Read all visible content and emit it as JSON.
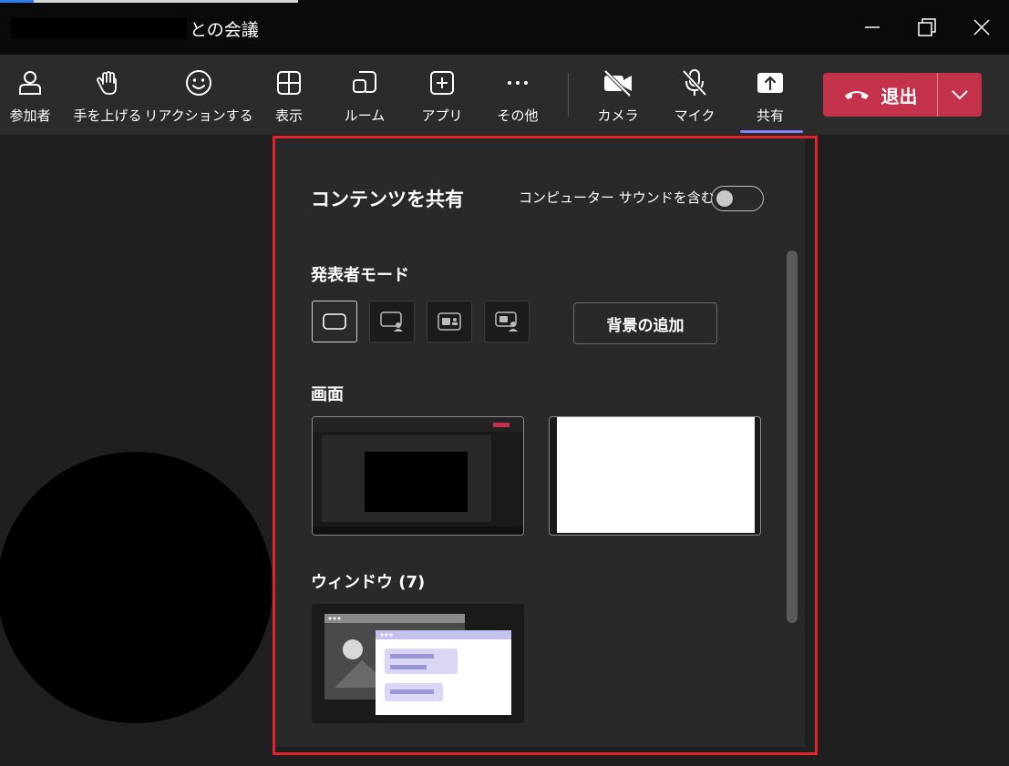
{
  "window": {
    "title": "との会議",
    "controls": [
      "minimize-icon",
      "restore-icon",
      "close-icon"
    ]
  },
  "toolbar": {
    "items": [
      {
        "label": "参加者",
        "icon": "people-icon"
      },
      {
        "label": "手を上げる",
        "icon": "raise-hand-icon"
      },
      {
        "label": "リアクションする",
        "icon": "smile-icon"
      },
      {
        "label": "表示",
        "icon": "grid-icon"
      },
      {
        "label": "ルーム",
        "icon": "breakout-rooms-icon"
      },
      {
        "label": "アプリ",
        "icon": "add-app-icon"
      },
      {
        "label": "その他",
        "icon": "more-icon"
      },
      {
        "label": "カメラ",
        "icon": "camera-off-icon"
      },
      {
        "label": "マイク",
        "icon": "mic-off-icon"
      },
      {
        "label": "共有",
        "icon": "share-screen-icon"
      }
    ],
    "leave": {
      "label": "退出",
      "icon": "hang-up-icon"
    }
  },
  "share_panel": {
    "title": "コンテンツを共有",
    "sound_label": "コンピューター サウンドを含む",
    "sound_toggle_on": false,
    "presenter_mode_heading": "発表者モード",
    "presenter_modes": [
      "content-only-icon",
      "standout-icon",
      "side-by-side-icon",
      "reporter-icon"
    ],
    "background_button": "背景の追加",
    "screens_heading": "画面",
    "windows_heading": "ウィンドウ (7)"
  },
  "colors": {
    "accent": "#7f85f5",
    "leave": "#c4314b",
    "highlight": "#e3242b"
  }
}
